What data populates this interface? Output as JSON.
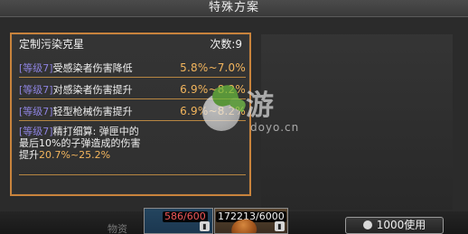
{
  "header": {
    "title": "特殊方案"
  },
  "panel": {
    "title": "定制污染克星",
    "count_label": "次数:9",
    "rows": [
      {
        "level": "[等级7]",
        "text": "受感染者伤害降低",
        "value": "5.8%~7.0%"
      },
      {
        "level": "[等级7]",
        "text": "对感染者伤害提升",
        "value": "6.9%~8.2%"
      },
      {
        "level": "[等级7]",
        "text": "轻型枪械伤害提升",
        "value": "6.9%~8.2%"
      },
      {
        "level": "[等级7]",
        "line1": "精打细算: 弹匣中的",
        "line2": "最后10%的子弹造成的伤害",
        "line3_prefix": "提升",
        "line3_value": "20.7%~25.2%"
      }
    ]
  },
  "watermark": {
    "main": "游",
    "sub": "doyo.cn",
    "colors": {
      "leaf_primary": "#69bb3d",
      "leaf_secondary": "#76c74b"
    }
  },
  "bottom": {
    "partial_label": "物资",
    "slot_a": {
      "quantity": "586/600",
      "icon": "lock-icon"
    },
    "slot_b": {
      "quantity": "172213/6000",
      "icon": "lock-icon"
    },
    "use_button": {
      "label": "1000使用",
      "icon": "token-icon"
    }
  },
  "colors": {
    "accent_border": "#c8833c",
    "level_text": "#8d83df",
    "value_text": "#f3b55d",
    "warning_text": "#ef5757"
  }
}
